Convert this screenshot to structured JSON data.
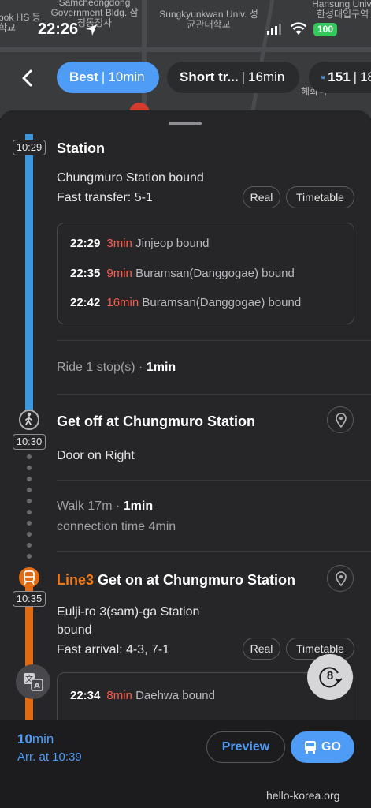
{
  "map": {
    "labels": [
      "Samcheongdong Government Bldg. 삼청동정사",
      "Sungkyunkwan Univ. 성균관대학교",
      "Hansung Univ. 한성대입구역",
      "bok HS 등학교",
      "혜화역"
    ]
  },
  "status_bar": {
    "time": "22:26",
    "battery": "100"
  },
  "tabs": {
    "best": {
      "label": "Best",
      "time": "10min"
    },
    "short": {
      "label": "Short tr...",
      "time": "16min"
    },
    "bus": {
      "label": "151",
      "extra": "18"
    }
  },
  "segment1": {
    "time": "10:29",
    "title": "Station",
    "bound": "Chungmuro Station bound",
    "transfer": "Fast transfer: 5-1",
    "real_label": "Real",
    "timetable_label": "Timetable",
    "arrivals": [
      {
        "time": "22:29",
        "wait": "3min",
        "dest": "Jinjeop bound"
      },
      {
        "time": "22:35",
        "wait": "9min",
        "dest": "Buramsan(Danggogae) bound"
      },
      {
        "time": "22:42",
        "wait": "16min",
        "dest": "Buramsan(Danggogae) bound"
      }
    ],
    "ride_prefix": "Ride 1 stop(s) · ",
    "ride_time": "1min"
  },
  "segment2": {
    "time": "10:30",
    "title": "Get off at Chungmuro Station",
    "door": "Door on Right",
    "walk_prefix": "Walk 17m · ",
    "walk_time": "1min",
    "connection": "connection time 4min"
  },
  "segment3": {
    "time": "10:35",
    "line": "Line3",
    "title": " Get on at Chungmuro Station",
    "bound_line1": "Eulji-ro 3(sam)-ga Station",
    "bound_line2": "bound",
    "arrival": "Fast arrival: 4-3, 7-1",
    "real_label": "Real",
    "timetable_label": "Timetable",
    "arrivals": [
      {
        "time": "22:34",
        "wait": "8min",
        "dest": "Daehwa bound"
      }
    ]
  },
  "refresh_count": "8",
  "bottom": {
    "eta_value": "10",
    "eta_unit": "min",
    "arrival": "Arr. at 10:39",
    "preview_label": "Preview",
    "go_label": "GO"
  },
  "watermark": "hello-korea.org",
  "colors": {
    "accent": "#4e9cf6",
    "line4": "#3b98e0",
    "line3": "#e26b11",
    "wait": "#ff5a4a"
  }
}
